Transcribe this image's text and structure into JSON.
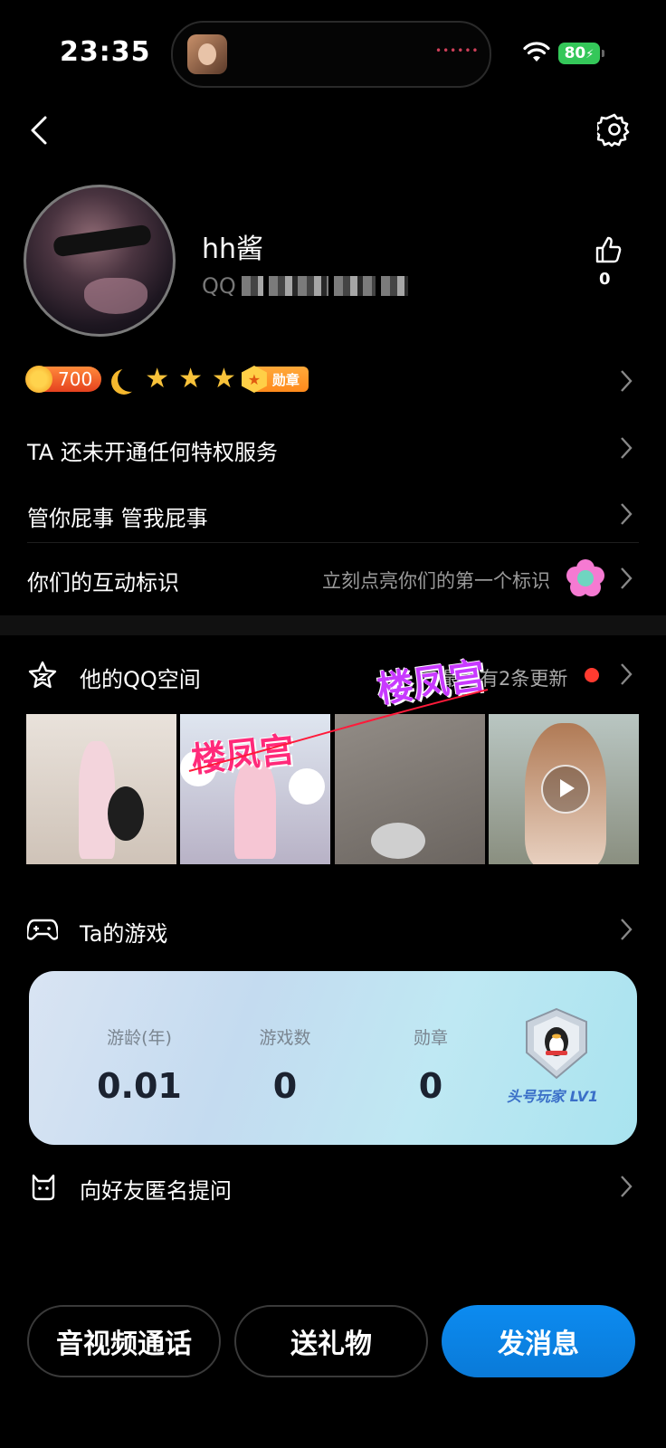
{
  "status_bar": {
    "time": "23:35",
    "battery": "80"
  },
  "profile": {
    "nickname": "hh酱",
    "qq_prefix": "QQ",
    "like_count": "0",
    "coin_level": "700",
    "medal_label": "勋章"
  },
  "rows": {
    "privilege": "TA 还未开通任何特权服务",
    "signature": "管你屁事 管我屁事",
    "interaction_label": "你们的互动标识",
    "interaction_hint": "立刻点亮你们的第一个标识"
  },
  "qzone": {
    "title": "他的QQ空间",
    "update_hint": "最近有2条更新",
    "watermark": "楼凤宫"
  },
  "games": {
    "title": "Ta的游戏",
    "stats": [
      {
        "label": "游龄(年)",
        "value": "0.01"
      },
      {
        "label": "游戏数",
        "value": "0"
      },
      {
        "label": "勋章",
        "value": "0"
      }
    ],
    "badge_title": "头号玩家 LV1"
  },
  "ask": {
    "title": "向好友匿名提问"
  },
  "actions": {
    "call": "音视频通话",
    "gift": "送礼物",
    "message": "发消息"
  },
  "colors": {
    "accent": "#0a84ff",
    "battery": "#34c759",
    "badge": "#ff8a1c"
  }
}
